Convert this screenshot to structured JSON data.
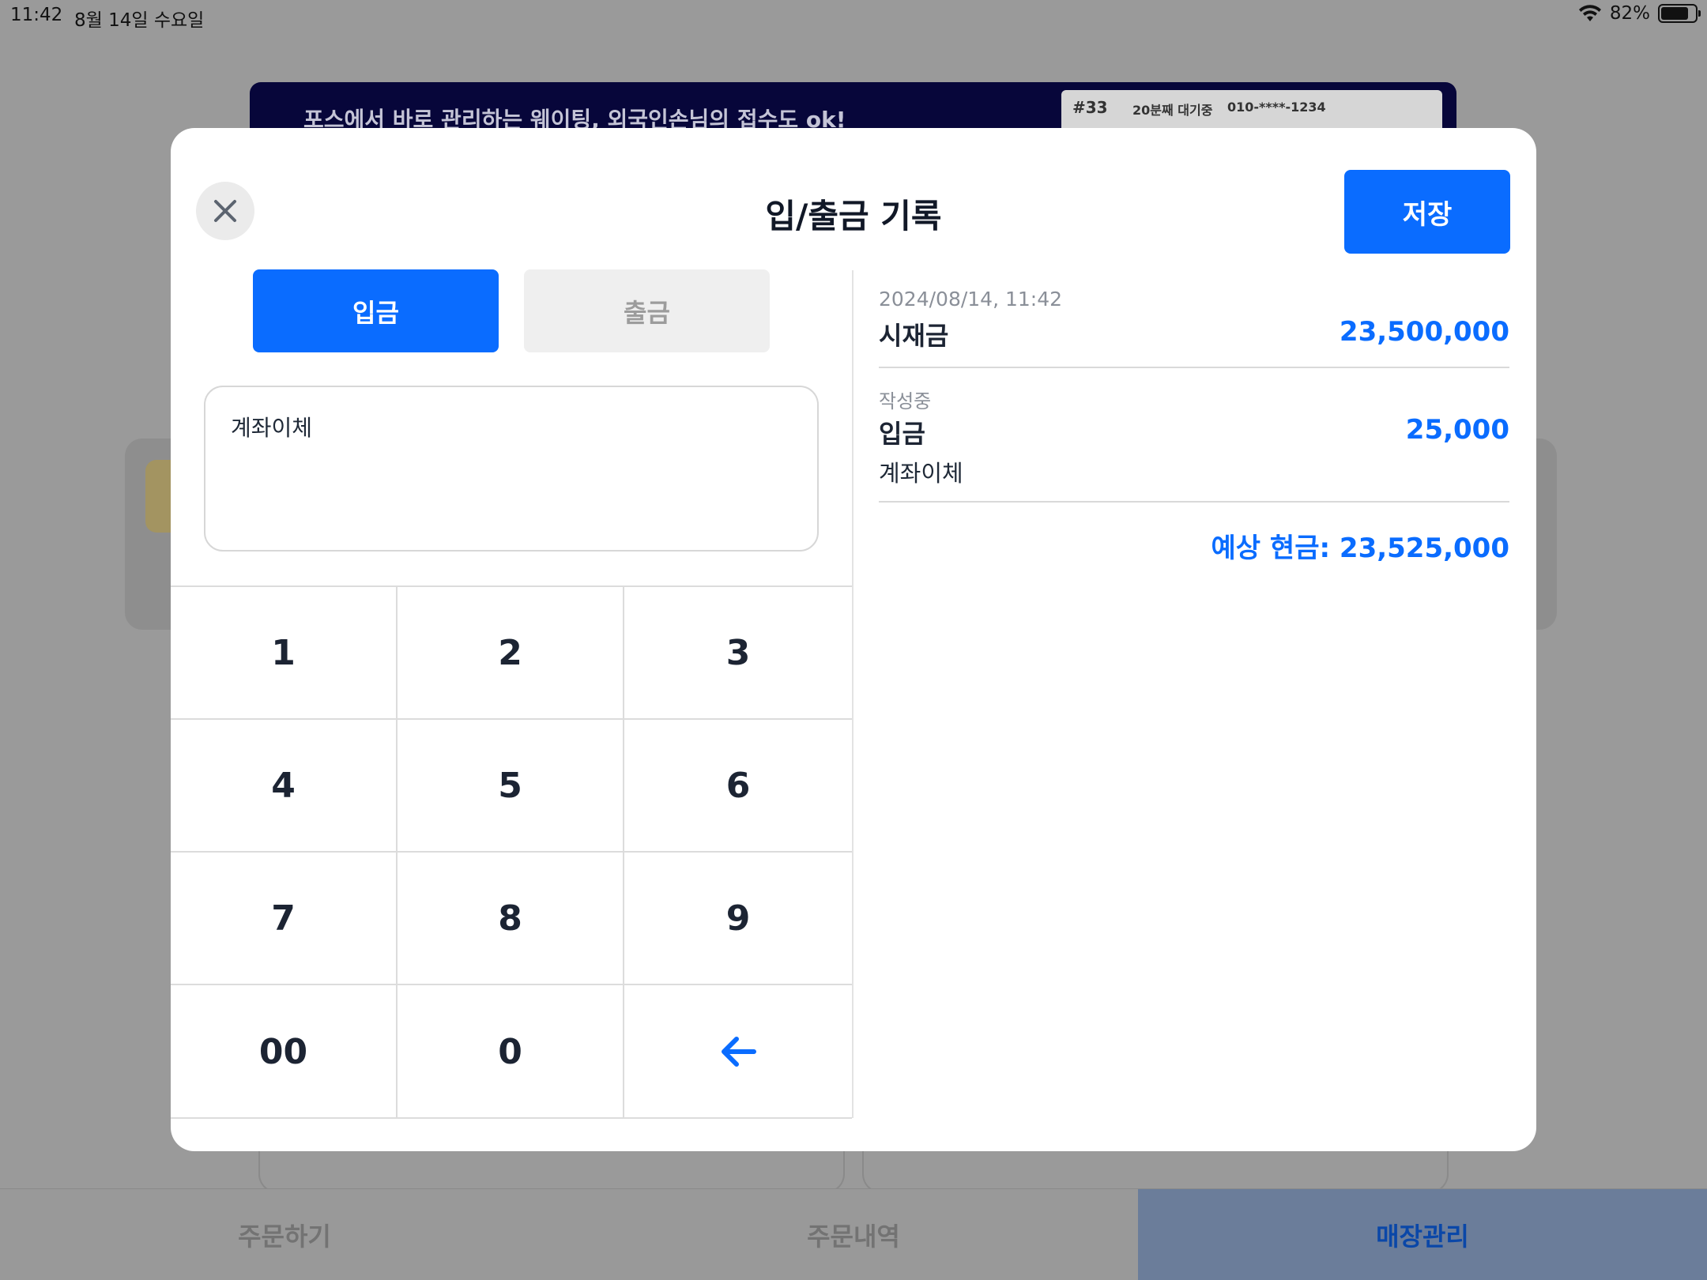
{
  "status_bar": {
    "time": "11:42",
    "date": "8월 14일 수요일",
    "battery": "82%",
    "battery_level": 0.82
  },
  "background": {
    "banner_text": "포스에서 바로 관리하는 웨이팅, 외국인손님의 접수도 ok!",
    "banner_card_number": "#33",
    "banner_card_wait": "20분째 대기중",
    "banner_card_phone": "010-****-1234"
  },
  "tabbar": {
    "tabs": [
      {
        "label": "주문하기"
      },
      {
        "label": "주문내역"
      },
      {
        "label": "매장관리"
      }
    ]
  },
  "modal": {
    "title": "입/출금 기록",
    "save_label": "저장",
    "segment": {
      "deposit_label": "입금",
      "withdraw_label": "출금",
      "selected": "입금"
    },
    "memo_value": "계좌이체",
    "keypad": [
      "1",
      "2",
      "3",
      "4",
      "5",
      "6",
      "7",
      "8",
      "9",
      "00",
      "0"
    ],
    "summary": {
      "date": "2024/08/14, 11:42",
      "float_label": "시재금",
      "float_amount": "23,500,000",
      "draft_status": "작성중",
      "draft_type": "입금",
      "draft_amount": "25,000",
      "draft_memo": "계좌이체",
      "expected_cash": "예상 현금: 23,525,000"
    }
  },
  "colors": {
    "accent": "#0a6cff",
    "text_dark": "#1c2433",
    "muted": "#8a8f98",
    "overlay": "#9a9a9a"
  }
}
